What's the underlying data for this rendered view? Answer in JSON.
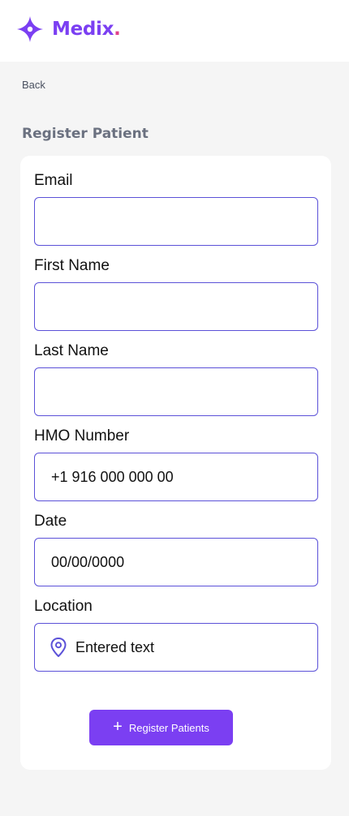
{
  "header": {
    "logo_text": "Medix",
    "logo_dot": ".",
    "brand_color": "#7b3ff2",
    "accent_color": "#e0408a"
  },
  "nav": {
    "back_label": "Back"
  },
  "page": {
    "title": "Register Patient"
  },
  "form": {
    "email": {
      "label": "Email",
      "value": ""
    },
    "first_name": {
      "label": "First Name",
      "value": ""
    },
    "last_name": {
      "label": "Last Name",
      "value": ""
    },
    "hmo_number": {
      "label": "HMO Number",
      "value": "+1 916 000 000 00"
    },
    "date": {
      "label": "Date",
      "value": "00/00/0000"
    },
    "location": {
      "label": "Location",
      "value": "Entered text",
      "icon": "location-pin-icon"
    }
  },
  "actions": {
    "register_label": "Register Patients",
    "register_icon": "plus-icon"
  }
}
